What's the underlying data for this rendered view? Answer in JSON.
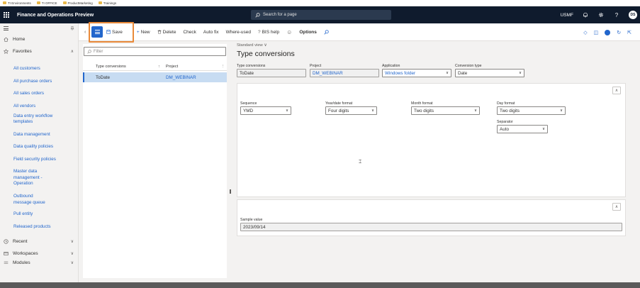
{
  "bookmarks": [
    "TI Environments",
    "TI OFFICE",
    "ProductMarketing",
    "Trainings"
  ],
  "nav": {
    "title": "Finance and Operations Preview",
    "search_placeholder": "Search for a page",
    "company": "USMF",
    "user_initials": "DS"
  },
  "leftnav": {
    "home": "Home",
    "favorites": "Favorites",
    "favorite_links": [
      "All customers",
      "All purchase orders",
      "All sales orders",
      "All vendors",
      "Data entry workflow templates",
      "Data management",
      "Data quality policies",
      "Field security policies",
      "Master data management - Operation",
      "Outbound message queue",
      "Pull entity",
      "Released products"
    ],
    "recent": "Recent",
    "workspaces": "Workspaces",
    "modules": "Modules"
  },
  "actions": {
    "save": "Save",
    "new": "New",
    "delete": "Delete",
    "check": "Check",
    "autofix": "Auto fix",
    "whereused": "Where-used",
    "bishelp": "BIS help",
    "options": "Options"
  },
  "list": {
    "filter_placeholder": "Filter",
    "col_type": "Type conversions",
    "col_project": "Project",
    "rows": [
      {
        "type": "ToDate",
        "project": "DM_WEBINAR"
      }
    ]
  },
  "detail": {
    "view": "Standard view",
    "title": "Type conversions",
    "labels": {
      "type_conversions": "Type conversions",
      "project": "Project",
      "application": "Application",
      "conversion_type": "Conversion type",
      "sequence": "Sequence",
      "year_format": "Year/date format",
      "month_format": "Month format",
      "day_format": "Day format",
      "separator": "Separator",
      "sample_value": "Sample value"
    },
    "values": {
      "type_conversions": "ToDate",
      "project": "DM_WEBINAR",
      "application": "Windows folder",
      "conversion_type": "Date",
      "sequence": "YMD",
      "year_format": "Four digits",
      "month_format": "Two digits",
      "day_format": "Two digits",
      "separator": "Auto",
      "sample_value": "2023/09/14"
    }
  },
  "colors": {
    "navbar": "#0f1b2d",
    "accent": "#2266cc",
    "highlight": "#e98a3a"
  }
}
